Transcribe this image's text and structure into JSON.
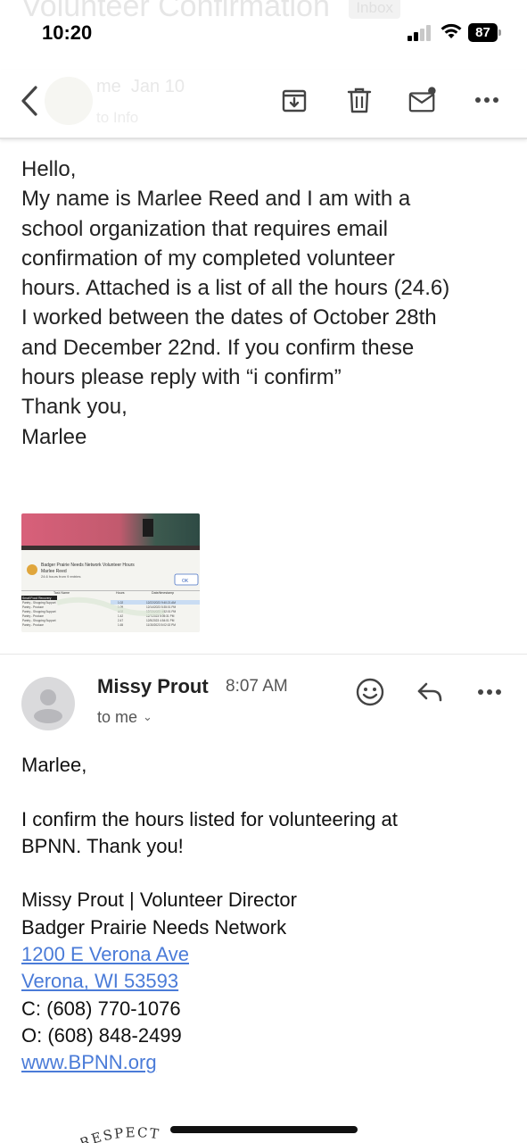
{
  "status_bar": {
    "time": "10:20",
    "battery": "87"
  },
  "ghost_header": {
    "subject": "Volunteer Confirmation",
    "badge": "Inbox",
    "from": "me",
    "date": "Jan 10",
    "to": "to Info"
  },
  "toolbar": {
    "icons": [
      "back-icon",
      "archive-icon",
      "trash-icon",
      "mark-unread-icon",
      "more-icon"
    ]
  },
  "message1": {
    "lines": [
      "Hello,",
      "My name is Marlee Reed and I am with a",
      "school organization that requires email",
      "confirmation of my completed volunteer",
      "hours. Attached is a list of all the hours (24.6)",
      "I worked between the dates of October 28th",
      "and December 22nd. If you confirm these",
      "hours please reply with “i confirm”",
      "Thank you,",
      "Marlee"
    ],
    "attachment": {
      "org_title": "Badger Prairie Needs Network Volunteer Hours",
      "name": "Marlee Reed",
      "hours_line": "24.6 hours from 9 entries",
      "ok_label": "OK",
      "col_headers": [
        "Task Name",
        "Hours",
        "Date/timestamp"
      ],
      "rows": [
        [
          "Small Food Recovery",
          "",
          ""
        ],
        [
          "Pantry - Shopping Support",
          "1.02",
          "12/22/2023 9:40:21 AM"
        ],
        [
          "Pantry - Produce",
          "1.09",
          "12/14/2023 5:35:01 PM"
        ],
        [
          "Pantry - Shopping Support",
          "4.02",
          "12/13/2023 4:52:01 PM"
        ],
        [
          "Pantry - Produce",
          "1.42",
          "12/7/2023 5:05:31 PM"
        ],
        [
          "Pantry - Shopping Support",
          "2.47",
          "12/5/2023 4:54:01 PM"
        ],
        [
          "Pantry - Produce",
          "1.65",
          "11/30/2023 5:02:02 PM"
        ]
      ]
    }
  },
  "message2": {
    "sender": "Missy Prout",
    "time": "8:07 AM",
    "to": "to me",
    "greeting": "Marlee,",
    "body": [
      "I confirm the hours listed for volunteering at",
      "BPNN. Thank you!"
    ],
    "signature": {
      "name_title": "Missy Prout | Volunteer Director",
      "org": "Badger Prairie Needs Network",
      "address1": "1200 E Verona Ave",
      "address2": "Verona, WI 53593",
      "cell": "C: (608) 770-1076",
      "office": "O: (608) 848-2499",
      "website": "www.BPNN.org"
    },
    "footer_logo_text": "RESPECT"
  },
  "colors": {
    "link": "#4a7bd8",
    "text": "#222222",
    "divider": "#e6e6e6"
  }
}
